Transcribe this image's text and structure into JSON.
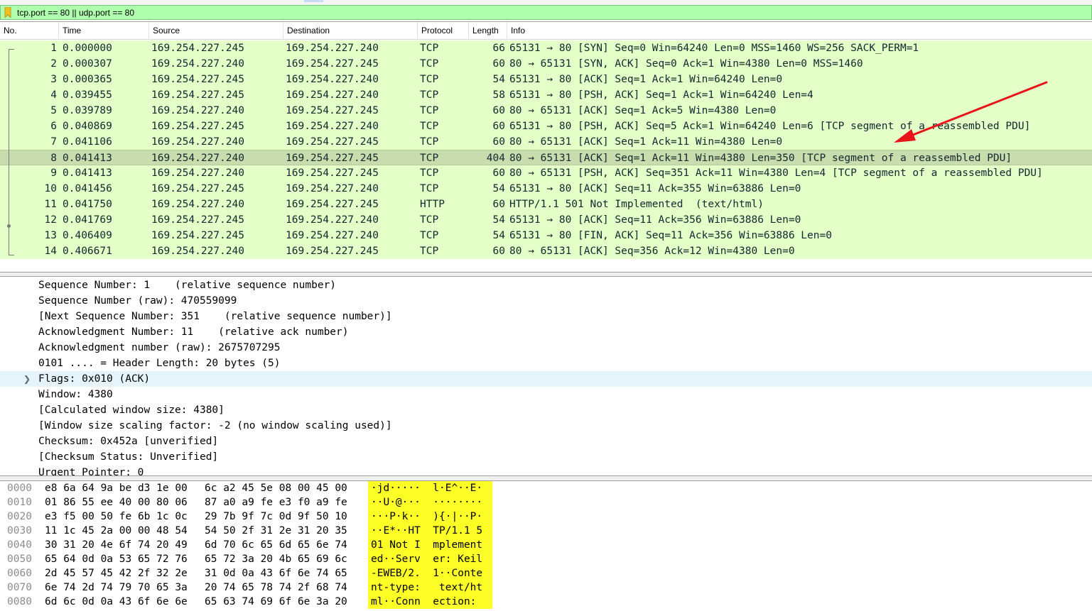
{
  "filter": {
    "text": "tcp.port == 80 || udp.port == 80"
  },
  "columns": [
    "No.",
    "Time",
    "Source",
    "Destination",
    "Protocol",
    "Length",
    "Info"
  ],
  "packets": [
    {
      "no": "1",
      "time": "0.000000",
      "src": "169.254.227.245",
      "dst": "169.254.227.240",
      "proto": "TCP",
      "len": "66",
      "info": "65131 → 80 [SYN] Seq=0 Win=64240 Len=0 MSS=1460 WS=256 SACK_PERM=1"
    },
    {
      "no": "2",
      "time": "0.000307",
      "src": "169.254.227.240",
      "dst": "169.254.227.245",
      "proto": "TCP",
      "len": "60",
      "info": "80 → 65131 [SYN, ACK] Seq=0 Ack=1 Win=4380 Len=0 MSS=1460"
    },
    {
      "no": "3",
      "time": "0.000365",
      "src": "169.254.227.245",
      "dst": "169.254.227.240",
      "proto": "TCP",
      "len": "54",
      "info": "65131 → 80 [ACK] Seq=1 Ack=1 Win=64240 Len=0"
    },
    {
      "no": "4",
      "time": "0.039455",
      "src": "169.254.227.245",
      "dst": "169.254.227.240",
      "proto": "TCP",
      "len": "58",
      "info": "65131 → 80 [PSH, ACK] Seq=1 Ack=1 Win=64240 Len=4"
    },
    {
      "no": "5",
      "time": "0.039789",
      "src": "169.254.227.240",
      "dst": "169.254.227.245",
      "proto": "TCP",
      "len": "60",
      "info": "80 → 65131 [ACK] Seq=1 Ack=5 Win=4380 Len=0"
    },
    {
      "no": "6",
      "time": "0.040869",
      "src": "169.254.227.245",
      "dst": "169.254.227.240",
      "proto": "TCP",
      "len": "60",
      "info": "65131 → 80 [PSH, ACK] Seq=5 Ack=1 Win=64240 Len=6 [TCP segment of a reassembled PDU]"
    },
    {
      "no": "7",
      "time": "0.041106",
      "src": "169.254.227.240",
      "dst": "169.254.227.245",
      "proto": "TCP",
      "len": "60",
      "info": "80 → 65131 [ACK] Seq=1 Ack=11 Win=4380 Len=0"
    },
    {
      "no": "8",
      "time": "0.041413",
      "src": "169.254.227.240",
      "dst": "169.254.227.245",
      "proto": "TCP",
      "len": "404",
      "info": "80 → 65131 [ACK] Seq=1 Ack=11 Win=4380 Len=350 [TCP segment of a reassembled PDU]"
    },
    {
      "no": "9",
      "time": "0.041413",
      "src": "169.254.227.240",
      "dst": "169.254.227.245",
      "proto": "TCP",
      "len": "60",
      "info": "80 → 65131 [PSH, ACK] Seq=351 Ack=11 Win=4380 Len=4 [TCP segment of a reassembled PDU]"
    },
    {
      "no": "10",
      "time": "0.041456",
      "src": "169.254.227.245",
      "dst": "169.254.227.240",
      "proto": "TCP",
      "len": "54",
      "info": "65131 → 80 [ACK] Seq=11 Ack=355 Win=63886 Len=0"
    },
    {
      "no": "11",
      "time": "0.041750",
      "src": "169.254.227.240",
      "dst": "169.254.227.245",
      "proto": "HTTP",
      "len": "60",
      "info": "HTTP/1.1 501 Not Implemented  (text/html)"
    },
    {
      "no": "12",
      "time": "0.041769",
      "src": "169.254.227.245",
      "dst": "169.254.227.240",
      "proto": "TCP",
      "len": "54",
      "info": "65131 → 80 [ACK] Seq=11 Ack=356 Win=63886 Len=0"
    },
    {
      "no": "13",
      "time": "0.406409",
      "src": "169.254.227.245",
      "dst": "169.254.227.240",
      "proto": "TCP",
      "len": "54",
      "info": "65131 → 80 [FIN, ACK] Seq=11 Ack=356 Win=63886 Len=0"
    },
    {
      "no": "14",
      "time": "0.406671",
      "src": "169.254.227.240",
      "dst": "169.254.227.245",
      "proto": "TCP",
      "len": "60",
      "info": "80 → 65131 [ACK] Seq=356 Ack=12 Win=4380 Len=0"
    }
  ],
  "selected_packet": "8",
  "details": [
    "Sequence Number: 1    (relative sequence number)",
    "Sequence Number (raw): 470559099",
    "[Next Sequence Number: 351    (relative sequence number)]",
    "Acknowledgment Number: 11    (relative ack number)",
    "Acknowledgment number (raw): 2675707295",
    "0101 .... = Header Length: 20 bytes (5)",
    "Flags: 0x010 (ACK)",
    "Window: 4380",
    "[Calculated window size: 4380]",
    "[Window size scaling factor: -2 (no window scaling used)]",
    "Checksum: 0x452a [unverified]",
    "[Checksum Status: Unverified]",
    "Urgent Pointer: 0"
  ],
  "details_highlight_index": 6,
  "bytes": [
    {
      "offset": "0000",
      "hex1": "e8 6a 64 9a be d3 1e 00",
      "hex2": "6c a2 45 5e 08 00 45 00",
      "ascii": "·jd·····  l·E^··E·"
    },
    {
      "offset": "0010",
      "hex1": "01 86 55 ee 40 00 80 06",
      "hex2": "87 a0 a9 fe e3 f0 a9 fe",
      "ascii": "··U·@···  ········"
    },
    {
      "offset": "0020",
      "hex1": "e3 f5 00 50 fe 6b 1c 0c",
      "hex2": "29 7b 9f 7c 0d 9f 50 10",
      "ascii": "···P·k··  ){·|··P·"
    },
    {
      "offset": "0030",
      "hex1": "11 1c 45 2a 00 00 48 54",
      "hex2": "54 50 2f 31 2e 31 20 35",
      "ascii": "··E*··HT  TP/1.1 5"
    },
    {
      "offset": "0040",
      "hex1": "30 31 20 4e 6f 74 20 49",
      "hex2": "6d 70 6c 65 6d 65 6e 74",
      "ascii": "01 Not I  mplement"
    },
    {
      "offset": "0050",
      "hex1": "65 64 0d 0a 53 65 72 76",
      "hex2": "65 72 3a 20 4b 65 69 6c",
      "ascii": "ed··Serv  er: Keil"
    },
    {
      "offset": "0060",
      "hex1": "2d 45 57 45 42 2f 32 2e",
      "hex2": "31 0d 0a 43 6f 6e 74 65",
      "ascii": "-EWEB/2.  1··Conte"
    },
    {
      "offset": "0070",
      "hex1": "6e 74 2d 74 79 70 65 3a",
      "hex2": "20 74 65 78 74 2f 68 74",
      "ascii": "nt-type:   text/ht"
    },
    {
      "offset": "0080",
      "hex1": "6d 6c 0d 0a 43 6f 6e 6e",
      "hex2": "65 63 74 69 6f 6e 3a 20",
      "ascii": "ml··Conn  ection: "
    }
  ],
  "colors": {
    "filter_bg": "#afffaf",
    "tcp_row": "#e4ffc7",
    "selected_row": "#c9dcae",
    "arrow": "#e8141a",
    "ascii_highlight": "#ffff28"
  },
  "icons": {
    "bookmark": "bookmark-icon",
    "expander": "chevron-right-icon",
    "annotation": "arrow-annotation"
  }
}
